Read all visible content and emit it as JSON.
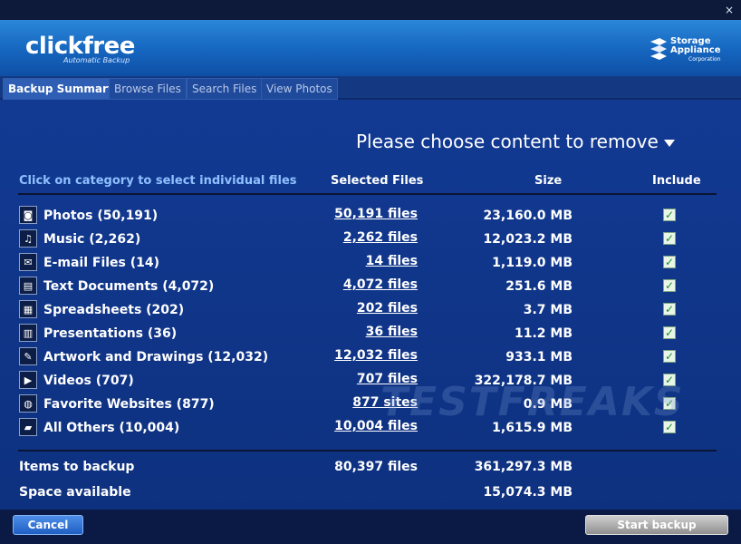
{
  "window": {
    "close_label": "×"
  },
  "brand": {
    "logo": "clickfree",
    "tagline": "Automatic Backup",
    "partner_line1": "Storage",
    "partner_line2": "Appliance",
    "partner_line3": "Corporation"
  },
  "tabs": [
    {
      "label": "Backup Summary",
      "active": true
    },
    {
      "label": "Browse Files",
      "active": false
    },
    {
      "label": "Search Files",
      "active": false
    },
    {
      "label": "View Photos",
      "active": false
    }
  ],
  "main": {
    "prompt": "Please choose content to remove",
    "columns": {
      "hint": "Click on category to select individual files",
      "selected": "Selected Files",
      "size": "Size",
      "include": "Include"
    },
    "rows": [
      {
        "name": "Photos (50,191)",
        "link": "50,191 files",
        "size": "23,160.0 MB",
        "icon": "camera-icon",
        "glyph": "◙",
        "included": true
      },
      {
        "name": "Music (2,262)",
        "link": "2,262 files",
        "size": "12,023.2 MB",
        "icon": "music-icon",
        "glyph": "♫",
        "included": true
      },
      {
        "name": "E-mail Files (14)",
        "link": "14 files",
        "size": "1,119.0 MB",
        "icon": "envelope-icon",
        "glyph": "✉",
        "included": true
      },
      {
        "name": "Text Documents (4,072)",
        "link": "4,072 files",
        "size": "251.6 MB",
        "icon": "document-icon",
        "glyph": "▤",
        "included": true
      },
      {
        "name": "Spreadsheets (202)",
        "link": "202 files",
        "size": "3.7 MB",
        "icon": "spreadsheet-icon",
        "glyph": "▦",
        "included": true
      },
      {
        "name": "Presentations (36)",
        "link": "36 files",
        "size": "11.2 MB",
        "icon": "presentation-icon",
        "glyph": "▥",
        "included": true
      },
      {
        "name": "Artwork and Drawings (12,032)",
        "link": "12,032 files",
        "size": "933.1 MB",
        "icon": "palette-icon",
        "glyph": "✎",
        "included": true
      },
      {
        "name": "Videos (707)",
        "link": "707 files",
        "size": "322,178.7 MB",
        "icon": "video-icon",
        "glyph": "▶",
        "included": true
      },
      {
        "name": "Favorite Websites (877)",
        "link": "877 sites",
        "size": "0.9 MB",
        "icon": "globe-icon",
        "glyph": "◍",
        "included": true
      },
      {
        "name": "All Others (10,004)",
        "link": "10,004 files",
        "size": "1,615.9 MB",
        "icon": "folder-icon",
        "glyph": "▰",
        "included": true
      }
    ],
    "summary": {
      "items_label": "Items to backup",
      "items_files": "80,397 files",
      "items_size": "361,297.3 MB",
      "space_label": "Space available",
      "space_size": "15,074.3 MB"
    },
    "watermark": "TESTFREAKS"
  },
  "footer": {
    "cancel_label": "Cancel",
    "start_label": "Start backup"
  },
  "colors": {
    "accent": "#2a87d8",
    "background": "#123a93",
    "hint": "#8fc0ff",
    "check": "#1b8f2a"
  }
}
